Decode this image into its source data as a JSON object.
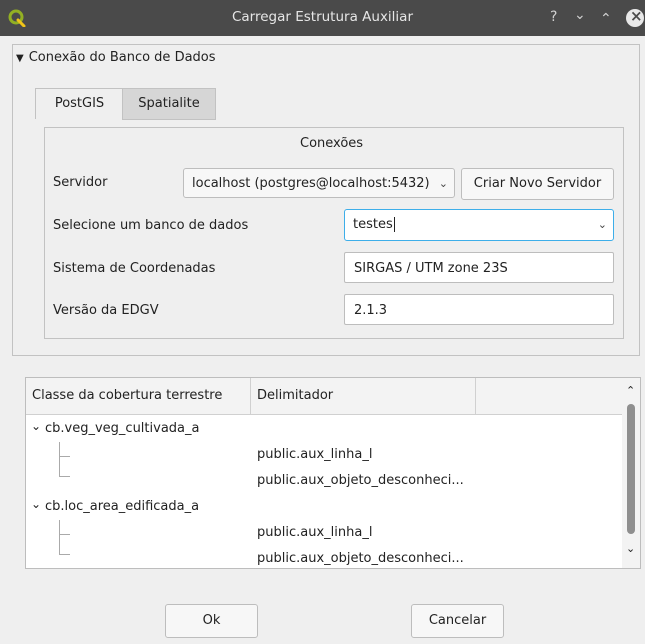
{
  "window": {
    "title": "Carregar Estrutura Auxiliar",
    "help": "?",
    "minimize": "⌄",
    "maximize": "⌃",
    "close": "×"
  },
  "group": {
    "header": "Conexão do Banco de Dados",
    "toggle": "▼"
  },
  "tabs": [
    {
      "label": "PostGIS",
      "active": true
    },
    {
      "label": "Spatialite",
      "active": false
    }
  ],
  "connections": {
    "title": "Conexões",
    "server_label": "Servidor",
    "server_value": "localhost (postgres@localhost:5432)",
    "create_server_label": "Criar Novo Servidor",
    "database_label": "Selecione um banco de dados",
    "database_value": "testes",
    "crs_label": "Sistema de Coordenadas",
    "crs_value": "SIRGAS / UTM zone 23S",
    "edgv_label": "Versão da EDGV",
    "edgv_value": "2.1.3",
    "chevron": "⌄"
  },
  "tree": {
    "columns": [
      "Classe da cobertura terrestre",
      "Delimitador",
      ""
    ],
    "rows": [
      {
        "class": "cb.veg_veg_cultivada_a",
        "delimiter": ""
      },
      {
        "class": "",
        "delimiter": "public.aux_linha_l"
      },
      {
        "class": "",
        "delimiter": "public.aux_objeto_desconheci..."
      },
      {
        "class": "cb.loc_area_edificada_a",
        "delimiter": ""
      },
      {
        "class": "",
        "delimiter": "public.aux_linha_l"
      },
      {
        "class": "",
        "delimiter": "public.aux_objeto_desconheci..."
      }
    ],
    "expander": "⌄",
    "scroll_up": "⌃",
    "scroll_down": "⌄"
  },
  "buttons": {
    "ok": "Ok",
    "cancel": "Cancelar"
  },
  "colors": {
    "titlebar": "#4a4a4a",
    "accent": "#3daee9",
    "qgis_green": "#93b023"
  }
}
